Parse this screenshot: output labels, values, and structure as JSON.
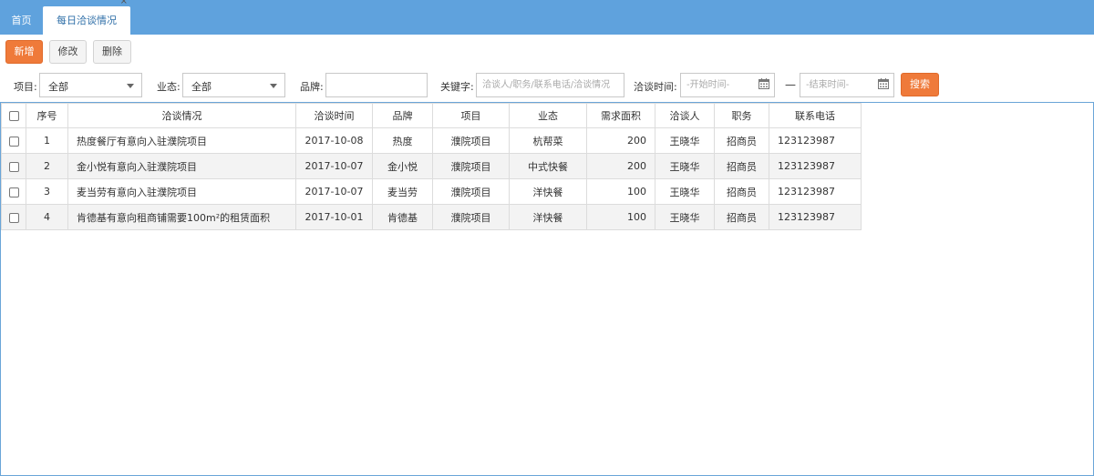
{
  "tabs": {
    "home": "首页",
    "active": "每日洽谈情况",
    "close_glyph": "×"
  },
  "toolbar": {
    "add": "新增",
    "edit": "修改",
    "delete": "删除"
  },
  "filters": {
    "project_label": "项目:",
    "project_value": "全部",
    "format_label": "业态:",
    "format_value": "全部",
    "brand_label": "品牌:",
    "brand_value": "",
    "keyword_label": "关键字:",
    "keyword_placeholder": "洽谈人/职务/联系电话/洽谈情况",
    "time_label": "洽谈时间:",
    "start_placeholder": "-开始时间-",
    "range_dash": "—",
    "end_placeholder": "-结束时间-",
    "search": "搜索"
  },
  "table": {
    "columns": [
      "序号",
      "洽谈情况",
      "洽谈时间",
      "品牌",
      "项目",
      "业态",
      "需求面积",
      "洽谈人",
      "职务",
      "联系电话"
    ],
    "rows": [
      {
        "no": "1",
        "desc": "热度餐厅有意向入驻濮院项目",
        "date": "2017-10-08",
        "brand": "热度",
        "project": "濮院项目",
        "format": "杭帮菜",
        "area": "200",
        "person": "王晓华",
        "title": "招商员",
        "phone": "123123987"
      },
      {
        "no": "2",
        "desc": "金小悦有意向入驻濮院项目",
        "date": "2017-10-07",
        "brand": "金小悦",
        "project": "濮院项目",
        "format": "中式快餐",
        "area": "200",
        "person": "王晓华",
        "title": "招商员",
        "phone": "123123987"
      },
      {
        "no": "3",
        "desc": "麦当劳有意向入驻濮院项目",
        "date": "2017-10-07",
        "brand": "麦当劳",
        "project": "濮院项目",
        "format": "洋快餐",
        "area": "100",
        "person": "王晓华",
        "title": "招商员",
        "phone": "123123987"
      },
      {
        "no": "4",
        "desc": "肯德基有意向租商铺需要100m²的租赁面积",
        "date": "2017-10-01",
        "brand": "肯德基",
        "project": "濮院项目",
        "format": "洋快餐",
        "area": "100",
        "person": "王晓华",
        "title": "招商员",
        "phone": "123123987"
      }
    ]
  },
  "colors": {
    "header_blue": "#5fa2dd",
    "accent_orange": "#ef7a3a",
    "grid_border": "#6aa5d8",
    "alt_row": "#f3f3f3"
  },
  "icons": {
    "calendar": "calendar-icon",
    "dropdown": "caret-down-icon",
    "close": "close-icon"
  }
}
